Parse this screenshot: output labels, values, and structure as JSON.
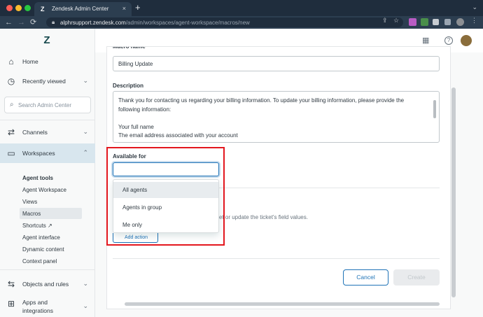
{
  "browser": {
    "tab_title": "Zendesk Admin Center",
    "tab_close": "×",
    "new_tab": "+",
    "url_host": "alphrsupport.zendesk.com",
    "url_path": "/admin/workspaces/agent-workspace/macros/new",
    "back": "←",
    "forward": "→",
    "reload": "⟳",
    "lock": "🔒",
    "share": "⇪",
    "bookmark": "☆",
    "more": "⋮",
    "tab_menu": "⌄",
    "colors": {
      "red": "#ff5f57",
      "yellow": "#febc2e",
      "green": "#28c840"
    }
  },
  "sidebar": {
    "logo": "Z",
    "home": "Home",
    "recently_viewed": "Recently viewed",
    "search_placeholder": "Search Admin Center",
    "channels": "Channels",
    "workspaces": "Workspaces",
    "sub_items": [
      "Agent tools",
      "Agent Workspace",
      "Views",
      "Macros",
      "Shortcuts ↗",
      "Agent interface",
      "Dynamic content",
      "Context panel"
    ],
    "objects_and_rules": "Objects and rules",
    "apps_and_integrations_line1": "Apps and",
    "apps_and_integrations_line2": "integrations",
    "chevron_down": "⌄",
    "chevron_up": "⌃"
  },
  "header": {
    "apps_icon": "▦",
    "help_icon": "?"
  },
  "form": {
    "macro_name_label": "Macro name",
    "macro_name_value": "Billing Update",
    "description_label": "Description",
    "description_lines": [
      "Thank you for contacting us regarding your billing information. To update your billing information, please provide the",
      "following information:",
      "",
      "Your full name",
      "The email address associated with your account"
    ],
    "available_for_label": "Available for",
    "available_for_value": "",
    "available_for_options": [
      "All agents",
      "Agents in group",
      "Me only"
    ],
    "actions_description": "et or update the ticket's field values.",
    "add_action": "Add action",
    "cancel": "Cancel",
    "create": "Create"
  }
}
